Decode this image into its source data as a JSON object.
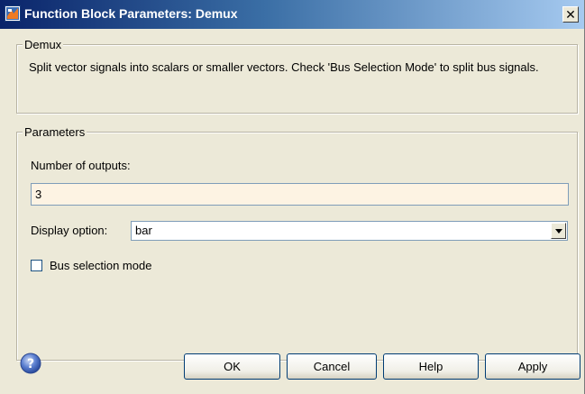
{
  "window": {
    "title": "Function Block Parameters: Demux",
    "close_glyph": "✕",
    "icon": "simulink-block-icon"
  },
  "demux_group": {
    "legend": "Demux",
    "description": "Split vector signals into scalars or smaller vectors. Check 'Bus Selection Mode' to split bus signals."
  },
  "parameters_group": {
    "legend": "Parameters",
    "num_outputs_label": "Number of outputs:",
    "num_outputs_value": "3",
    "display_option_label": "Display option:",
    "display_option_value": "bar",
    "bus_selection_label": "Bus selection mode",
    "bus_selection_checked": false
  },
  "buttons": {
    "ok": "OK",
    "cancel": "Cancel",
    "help": "Help",
    "apply": "Apply"
  },
  "colors": {
    "title_start": "#0a246a",
    "title_end": "#a6caf0",
    "dialog_bg": "#ece9d8",
    "input_bg": "#fdf3e3"
  }
}
